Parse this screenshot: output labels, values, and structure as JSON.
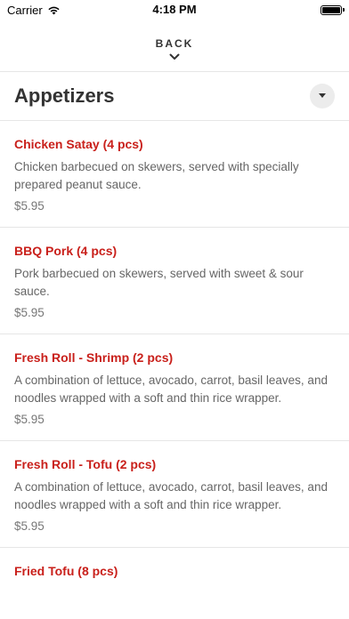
{
  "status_bar": {
    "carrier": "Carrier",
    "time": "4:18 PM"
  },
  "nav": {
    "back_label": "BACK"
  },
  "section": {
    "title": "Appetizers"
  },
  "items": [
    {
      "name": "Chicken Satay (4 pcs)",
      "description": "Chicken barbecued on skewers, served with specially prepared peanut sauce.",
      "price": "$5.95"
    },
    {
      "name": "BBQ Pork (4 pcs)",
      "description": "Pork barbecued on skewers, served with sweet & sour sauce.",
      "price": "$5.95"
    },
    {
      "name": "Fresh Roll - Shrimp (2 pcs)",
      "description": "A combination of lettuce, avocado, carrot, basil leaves, and noodles wrapped with a soft and thin rice wrapper.",
      "price": "$5.95"
    },
    {
      "name": "Fresh Roll - Tofu (2 pcs)",
      "description": "A combination of lettuce, avocado, carrot, basil leaves, and noodles wrapped with a soft and thin rice wrapper.",
      "price": "$5.95"
    },
    {
      "name": "Fried Tofu (8 pcs)",
      "description": "",
      "price": ""
    }
  ],
  "colors": {
    "item_name": "#c9201b",
    "divider": "#e6e6e6"
  },
  "icons": {
    "wifi": "wifi-icon",
    "battery": "battery-icon",
    "back": "chevron-down-icon",
    "dropdown": "caret-down-icon"
  }
}
